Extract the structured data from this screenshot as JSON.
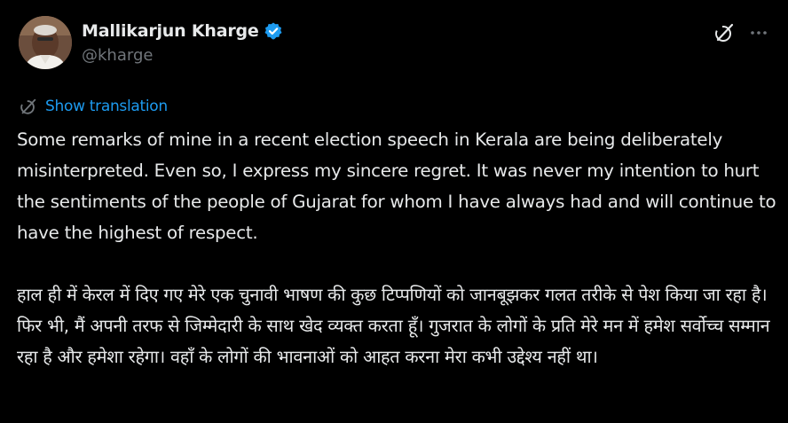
{
  "author": {
    "name": "Mallikarjun Kharge",
    "handle": "@kharge"
  },
  "actions": {
    "grok_icon": "grok-icon",
    "more_label": "···"
  },
  "translate": {
    "label": "Show translation"
  },
  "tweet": {
    "para_en": "Some remarks of mine in a recent election speech in Kerala are being deliberately misinterpreted. Even so, I express my sincere regret. It was never my intention to hurt the sentiments of the people of Gujarat for whom I have always had and will continue to have the highest of respect.",
    "para_hi": "हाल ही में केरल में दिए गए मेरे एक चुनावी भाषण की कुछ टिप्पणियों को जानबूझकर गलत तरीके से पेश किया जा रहा है। फिर भी, मैं अपनी तरफ से जिम्मेदारी के साथ  खेद व्यक्त करता हूँ। गुजरात के लोगों के प्रति मेरे मन में हमेश सर्वोच्च सम्मान रहा है और हमेशा रहेगा। वहाँ के लोगों की भावनाओं को आहत करना मेरा कभी उद्देश्य नहीं था।"
  },
  "colors": {
    "background": "#000000",
    "text_primary": "#e7e9ea",
    "text_secondary": "#71767b",
    "link": "#1d9bf0",
    "verified": "#1d9bf0"
  }
}
